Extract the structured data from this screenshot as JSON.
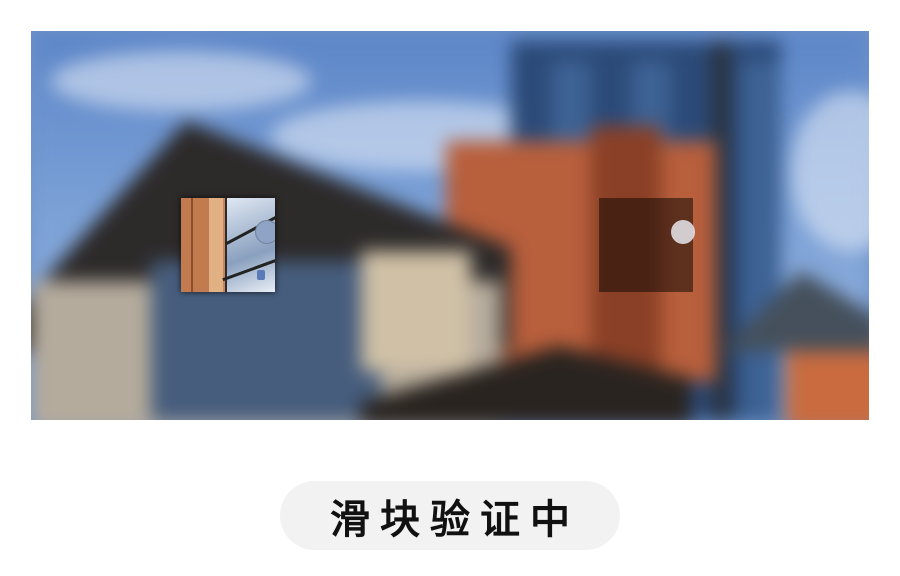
{
  "captcha": {
    "status_text": "滑块验证中",
    "background_image": "blurred-building-photo",
    "puzzle_piece": "puzzle-piece-icon",
    "target_slot": "puzzle-slot-icon"
  }
}
